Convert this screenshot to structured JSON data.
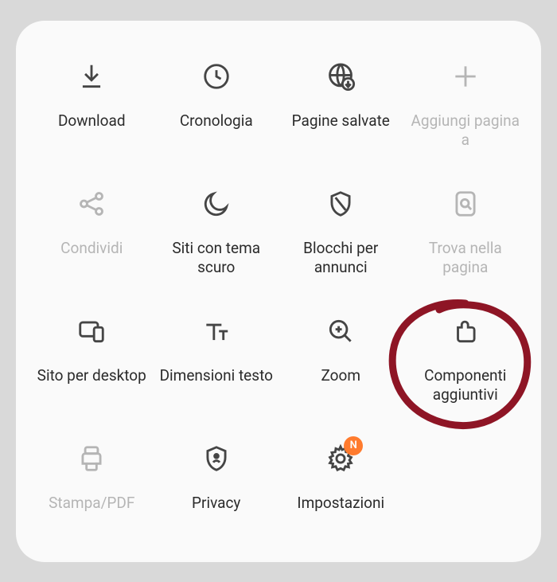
{
  "menu": {
    "items": [
      {
        "id": "download",
        "label": "Download",
        "icon": "download-icon",
        "enabled": true
      },
      {
        "id": "history",
        "label": "Cronologia",
        "icon": "clock-icon",
        "enabled": true
      },
      {
        "id": "saved-pages",
        "label": "Pagine salvate",
        "icon": "globe-down-icon",
        "enabled": true
      },
      {
        "id": "add-page-to",
        "label": "Aggiungi pagina a",
        "icon": "plus-icon",
        "enabled": false
      },
      {
        "id": "share",
        "label": "Condividi",
        "icon": "share-icon",
        "enabled": false
      },
      {
        "id": "dark-theme-sites",
        "label": "Siti con tema scuro",
        "icon": "moon-icon",
        "enabled": true
      },
      {
        "id": "ad-blockers",
        "label": "Blocchi per annunci",
        "icon": "shield-slash-icon",
        "enabled": true
      },
      {
        "id": "find-in-page",
        "label": "Trova nella pagina",
        "icon": "search-page-icon",
        "enabled": false
      },
      {
        "id": "desktop-site",
        "label": "Sito per desktop",
        "icon": "monitor-icon",
        "enabled": true
      },
      {
        "id": "text-size",
        "label": "Dimensioni testo",
        "icon": "text-size-icon",
        "enabled": true
      },
      {
        "id": "zoom",
        "label": "Zoom",
        "icon": "zoom-in-icon",
        "enabled": true
      },
      {
        "id": "addons",
        "label": "Componenti aggiuntivi",
        "icon": "puzzle-icon",
        "enabled": true,
        "highlighted": true
      },
      {
        "id": "print-pdf",
        "label": "Stampa/PDF",
        "icon": "printer-icon",
        "enabled": false
      },
      {
        "id": "privacy",
        "label": "Privacy",
        "icon": "privacy-shield-icon",
        "enabled": true
      },
      {
        "id": "settings",
        "label": "Impostazioni",
        "icon": "gear-icon",
        "enabled": true,
        "badge": "N"
      }
    ]
  },
  "colors": {
    "text_active": "#2b2b2b",
    "text_disabled": "#b5b5b5",
    "icon_stroke": "#454545",
    "badge_bg": "#ff7b2e",
    "annotation": "#8e1525"
  }
}
